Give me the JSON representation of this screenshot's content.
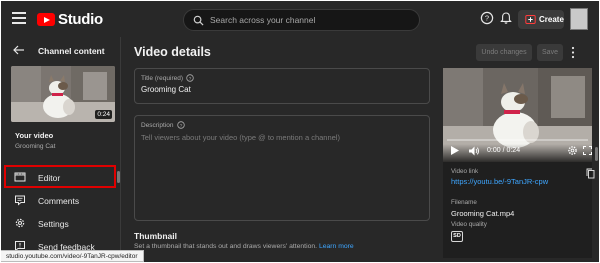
{
  "header": {
    "logo_text": "Studio",
    "search_placeholder": "Search across your channel",
    "create_label": "Create"
  },
  "sidebar": {
    "title": "Channel content",
    "video": {
      "duration": "0:24",
      "section_label": "Your video",
      "name": "Grooming Cat"
    },
    "items": [
      {
        "label": "Editor",
        "icon": "film-strip-icon",
        "highlighted": true
      },
      {
        "label": "Comments",
        "icon": "comments-icon"
      },
      {
        "label": "Settings",
        "icon": "gear-icon"
      },
      {
        "label": "Send feedback",
        "icon": "feedback-icon"
      }
    ]
  },
  "main": {
    "title": "Video details",
    "undo_label": "Undo changes",
    "save_label": "Save",
    "title_field": {
      "label": "Title (required)",
      "value": "Grooming Cat"
    },
    "description_field": {
      "label": "Description",
      "placeholder": "Tell viewers about your video (type @ to mention a channel)"
    },
    "thumbnail": {
      "heading": "Thumbnail",
      "subtitle": "Set a thumbnail that stands out and draws viewers' attention.",
      "learn_more": "Learn more"
    }
  },
  "preview": {
    "time": "0:00 / 0:24",
    "progress": 0,
    "video_link_label": "Video link",
    "video_link": "https://youtu.be/-9TanJR-cpw",
    "filename_label": "Filename",
    "filename": "Grooming Cat.mp4",
    "quality_label": "Video quality",
    "quality_badge": "SD"
  },
  "status_url": "studio.youtube.com/video/-9TanJR-cpw/editor",
  "colors": {
    "background": "#282828",
    "accent_red": "#ff0000",
    "link_blue": "#3ea6ff",
    "highlight_border": "#e00000"
  }
}
